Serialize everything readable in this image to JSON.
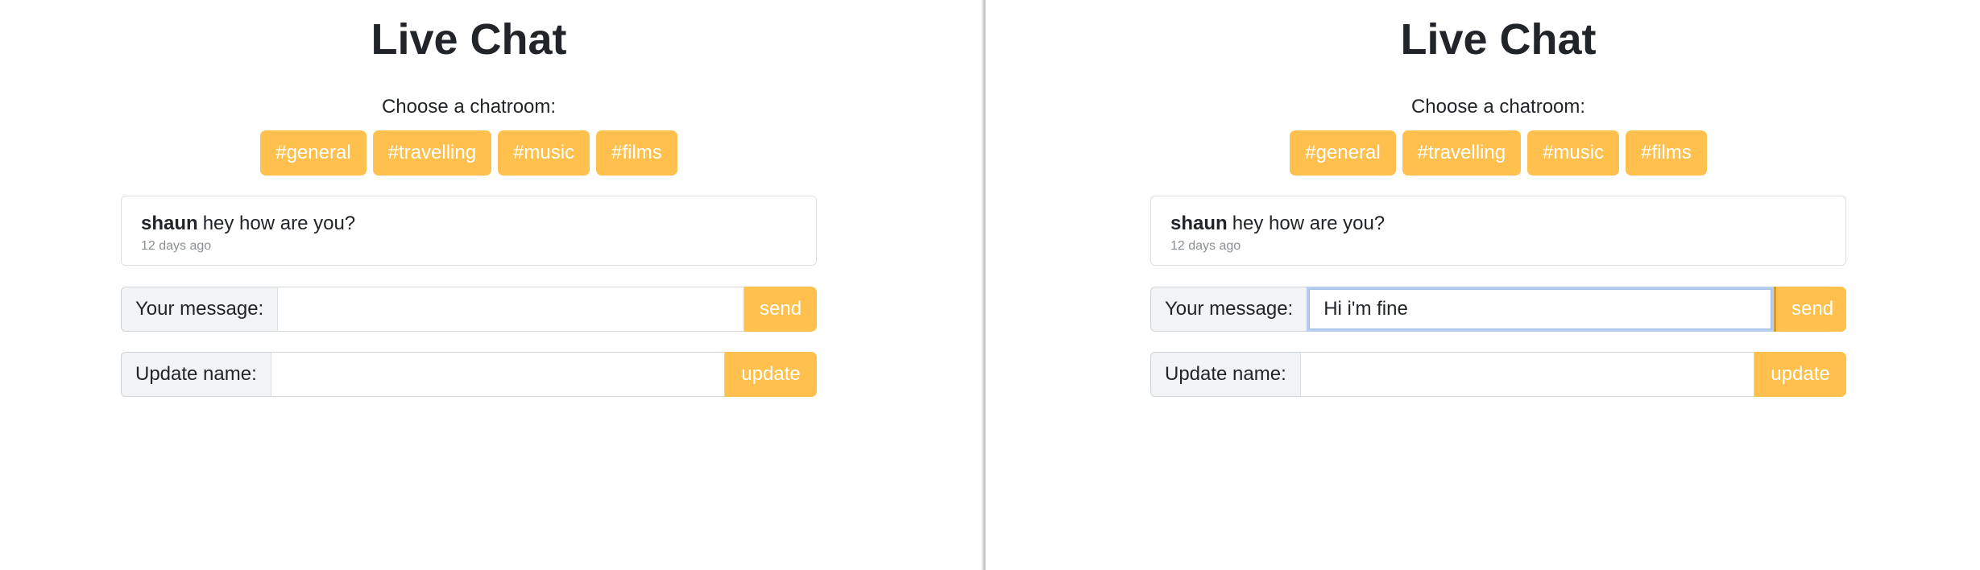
{
  "left_pane": {
    "title": "Live Chat",
    "choose_label": "Choose a chatroom:",
    "rooms": [
      {
        "label": "#general"
      },
      {
        "label": "#travelling"
      },
      {
        "label": "#music"
      },
      {
        "label": "#films"
      }
    ],
    "messages": [
      {
        "author": "shaun",
        "text": "hey how are you?",
        "time": "12 days ago"
      }
    ],
    "message_form": {
      "label": "Your message:",
      "value": "",
      "button": "send"
    },
    "name_form": {
      "label": "Update name:",
      "value": "",
      "button": "update"
    }
  },
  "right_pane": {
    "title": "Live Chat",
    "choose_label": "Choose a chatroom:",
    "rooms": [
      {
        "label": "#general"
      },
      {
        "label": "#travelling"
      },
      {
        "label": "#music"
      },
      {
        "label": "#films"
      }
    ],
    "messages": [
      {
        "author": "shaun",
        "text": "hey how are you?",
        "time": "12 days ago"
      }
    ],
    "message_form": {
      "label": "Your message:",
      "value": "Hi i'm fine",
      "button": "send"
    },
    "name_form": {
      "label": "Update name:",
      "value": "",
      "button": "update"
    }
  },
  "colors": {
    "accent": "#ffc04d",
    "focus_ring": "#b6cdf0"
  }
}
